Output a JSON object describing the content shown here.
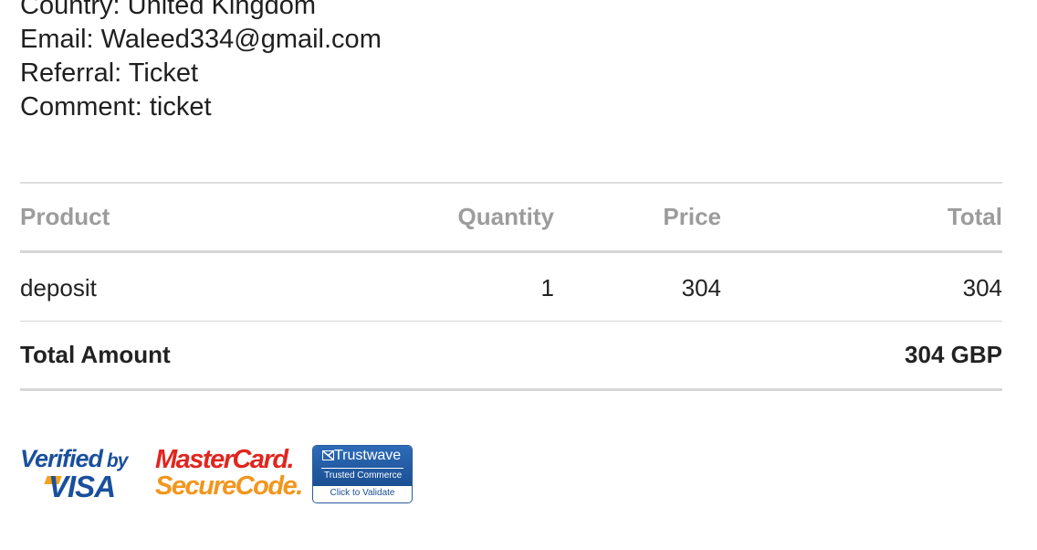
{
  "customer": {
    "country": "Country: United Kingdom",
    "email": "Email: Waleed334@gmail.com",
    "referral": "Referral: Ticket",
    "comment": "Comment: ticket"
  },
  "order": {
    "headers": {
      "product": "Product",
      "quantity": "Quantity",
      "price": "Price",
      "total": "Total"
    },
    "items": [
      {
        "product": "deposit",
        "quantity": "1",
        "price": "304",
        "total": "304"
      }
    ],
    "total_label": "Total Amount",
    "total_value": "304 GBP"
  },
  "badges": {
    "vbv_top": "Verified",
    "vbv_by": "by",
    "vbv_bottom": "VISA",
    "mc_top": "MasterCard.",
    "mc_bottom": "SecureCode.",
    "tw_logo": "Trustwave",
    "tw_sub": "Trusted Commerce",
    "tw_click": "Click to Validate",
    "colors": {
      "visa_blue": "#1a4f9c",
      "visa_gold": "#f4a11d",
      "mastercard_red": "#e0261f",
      "mastercard_orange": "#f2961c",
      "trustwave_blue": "#1b4f92"
    }
  }
}
